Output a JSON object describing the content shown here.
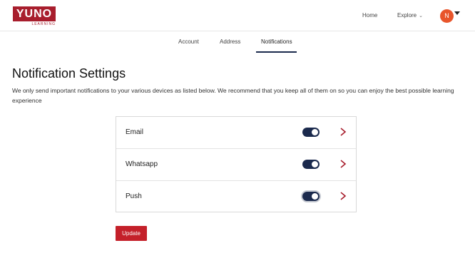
{
  "brand": {
    "logo_text": "YUNO",
    "logo_sub": "LEARNING",
    "color": "#a81e2d"
  },
  "header": {
    "nav": {
      "home": "Home",
      "explore": "Explore"
    },
    "avatar_initial": "N",
    "avatar_color": "#e8552b"
  },
  "tabs": [
    {
      "label": "Account"
    },
    {
      "label": "Address"
    },
    {
      "label": "Notifications",
      "active": true
    }
  ],
  "page": {
    "title": "Notification Settings",
    "description": "We only send important notifications to your various devices as listed below. We recommend that you keep all of them on so you can enjoy the best possible learning experience"
  },
  "channels": [
    {
      "label": "Email",
      "enabled": true
    },
    {
      "label": "Whatsapp",
      "enabled": true
    },
    {
      "label": "Push",
      "enabled": true
    }
  ],
  "actions": {
    "update_label": "Update",
    "update_color": "#c4202a"
  },
  "colors": {
    "toggle_on": "#1b2a4d",
    "arrow": "#a81e2d"
  }
}
